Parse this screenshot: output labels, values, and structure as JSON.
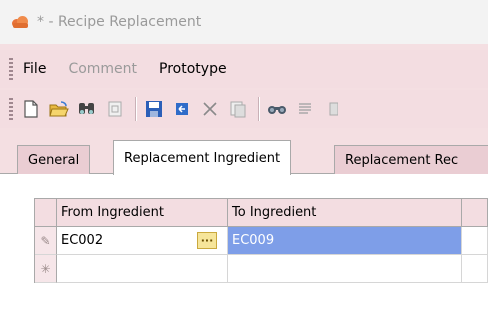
{
  "window": {
    "title": "* - Recipe Replacement"
  },
  "menu": {
    "items": [
      {
        "label": "File",
        "enabled": true
      },
      {
        "label": "Comment",
        "enabled": false
      },
      {
        "label": "Prototype",
        "enabled": true
      }
    ]
  },
  "toolbar": {
    "buttons": [
      "new-document-icon",
      "open-folder-icon",
      "find-icon",
      "properties-icon",
      "save-icon",
      "import-icon",
      "delete-icon",
      "copy-icon",
      "binoculars-icon",
      "list-icon"
    ]
  },
  "tabs": [
    {
      "label": "General",
      "active": false
    },
    {
      "label": "Replacement Ingredient",
      "active": true
    },
    {
      "label": "Replacement Rec",
      "active": false
    }
  ],
  "grid": {
    "columns": [
      "From Ingredient",
      "To Ingredient"
    ],
    "rows": [
      {
        "row_icon": "edit-pencil-icon",
        "glyph": "✎",
        "from": "EC002",
        "to": "EC009",
        "ellipsis": "···"
      },
      {
        "row_icon": "new-row-asterisk-icon",
        "glyph": "✳",
        "from": "",
        "to": ""
      }
    ]
  },
  "colors": {
    "selection": "#7e9ee8",
    "chrome": "#f3dde1",
    "accent": "#e8743a"
  }
}
